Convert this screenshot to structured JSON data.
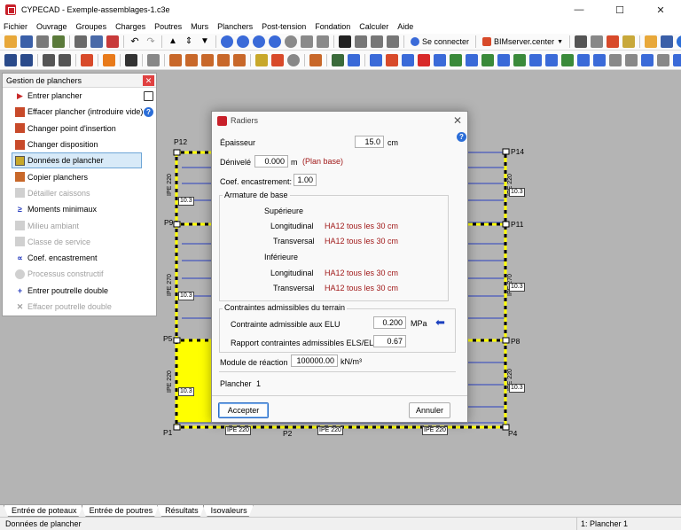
{
  "window": {
    "title": "CYPECAD - Exemple-assemblages-1.c3e",
    "controls": [
      "—",
      "☐",
      "✕"
    ]
  },
  "menu": [
    "Fichier",
    "Ouvrage",
    "Groupes",
    "Charges",
    "Poutres",
    "Murs",
    "Planchers",
    "Post-tension",
    "Fondation",
    "Calculer",
    "Aide"
  ],
  "toolbar": {
    "connect_label": "Se connecter",
    "bimserver_label": "BIMserver.center"
  },
  "panel": {
    "title": "Gestion de planchers",
    "close": "✕",
    "items": [
      {
        "label": "Entrer plancher",
        "icon": "enter-slab-icon",
        "enabled": true
      },
      {
        "label": "Effacer plancher (introduire vide)",
        "icon": "erase-slab-icon",
        "enabled": true
      },
      {
        "label": "Changer point d'insertion",
        "icon": "insertion-point-icon",
        "enabled": true
      },
      {
        "label": "Changer disposition",
        "icon": "disposition-icon",
        "enabled": true
      },
      {
        "label": "Données de plancher",
        "icon": "slab-data-icon",
        "enabled": true,
        "selected": true
      },
      {
        "label": "Copier planchers",
        "icon": "copy-slab-icon",
        "enabled": true
      },
      {
        "label": "Détailler caissons",
        "icon": "coffer-detail-icon",
        "enabled": false
      },
      {
        "label": "Moments minimaux",
        "icon": "moments-icon",
        "enabled": true
      },
      {
        "label": "Milieu ambiant",
        "icon": "environment-icon",
        "enabled": false
      },
      {
        "label": "Classe de service",
        "icon": "service-class-icon",
        "enabled": false
      },
      {
        "label": "Coef. encastrement",
        "icon": "fixity-coef-icon",
        "enabled": true
      },
      {
        "label": "Processus constructif",
        "icon": "construction-process-icon",
        "enabled": false
      },
      {
        "label": "Entrer poutrelle double",
        "icon": "add-joist-icon",
        "enabled": true
      },
      {
        "label": "Effacer poutrelle double",
        "icon": "delete-joist-icon",
        "enabled": false
      }
    ]
  },
  "drawing": {
    "columns": [
      "P12",
      "P14",
      "P9",
      "P11",
      "P5",
      "P8",
      "P1",
      "P2",
      "P4"
    ],
    "beam_sections": [
      "IPE 220",
      "IPE 270",
      "IPE 220",
      "IPE 220"
    ],
    "beam_tags": [
      "10.3",
      "10.3",
      "10.3",
      "10.3",
      "10.3",
      "10.3"
    ],
    "bottom_tags": [
      "IPE 220",
      "IPE 220",
      "IPE 220"
    ]
  },
  "dialog": {
    "title": "Radiers",
    "close": "✕",
    "help": "?",
    "epaisseur_label": "Épaisseur",
    "epaisseur_value": "15.0",
    "epaisseur_unit": "cm",
    "denivele_label": "Dénivelé",
    "denivele_value": "0.000",
    "denivele_unit": "m",
    "denivele_note": "(Plan base)",
    "coef_label": "Coef. encastrement:",
    "coef_value": "1.00",
    "armature_title": "Armature de base",
    "superieure_label": "Supérieure",
    "inferieure_label": "Inférieure",
    "longitudinal_label": "Longitudinal",
    "transversal_label": "Transversal",
    "sup_long_value": "HA12 tous les 30 cm",
    "sup_trans_value": "HA12 tous les 30 cm",
    "inf_long_value": "HA12 tous les 30 cm",
    "inf_trans_value": "HA12 tous les 30 cm",
    "contraintes_title": "Contraintes admissibles du terrain",
    "elu_label": "Contrainte admissible aux ELU",
    "elu_value": "0.200",
    "elu_unit": "MPa",
    "rapport_label": "Rapport contraintes admissibles ELS/ELU",
    "rapport_value": "0.67",
    "module_label": "Module de réaction",
    "module_value": "100000.00",
    "module_unit": "kN/m³",
    "plancher_label": "Plancher",
    "plancher_value": "1",
    "accept_label": "Accepter",
    "cancel_label": "Annuler"
  },
  "tabs": [
    "Entrée de poteaux",
    "Entrée de poutres",
    "Résultats",
    "Isovaleurs"
  ],
  "status": {
    "left": "Données de plancher",
    "right": "1: Plancher 1"
  },
  "colors": {
    "slab_fill": "#ffff00",
    "beam_blue": "#2a3fbf",
    "workspace": "#b4b4b4",
    "accent_red": "#a01818"
  }
}
